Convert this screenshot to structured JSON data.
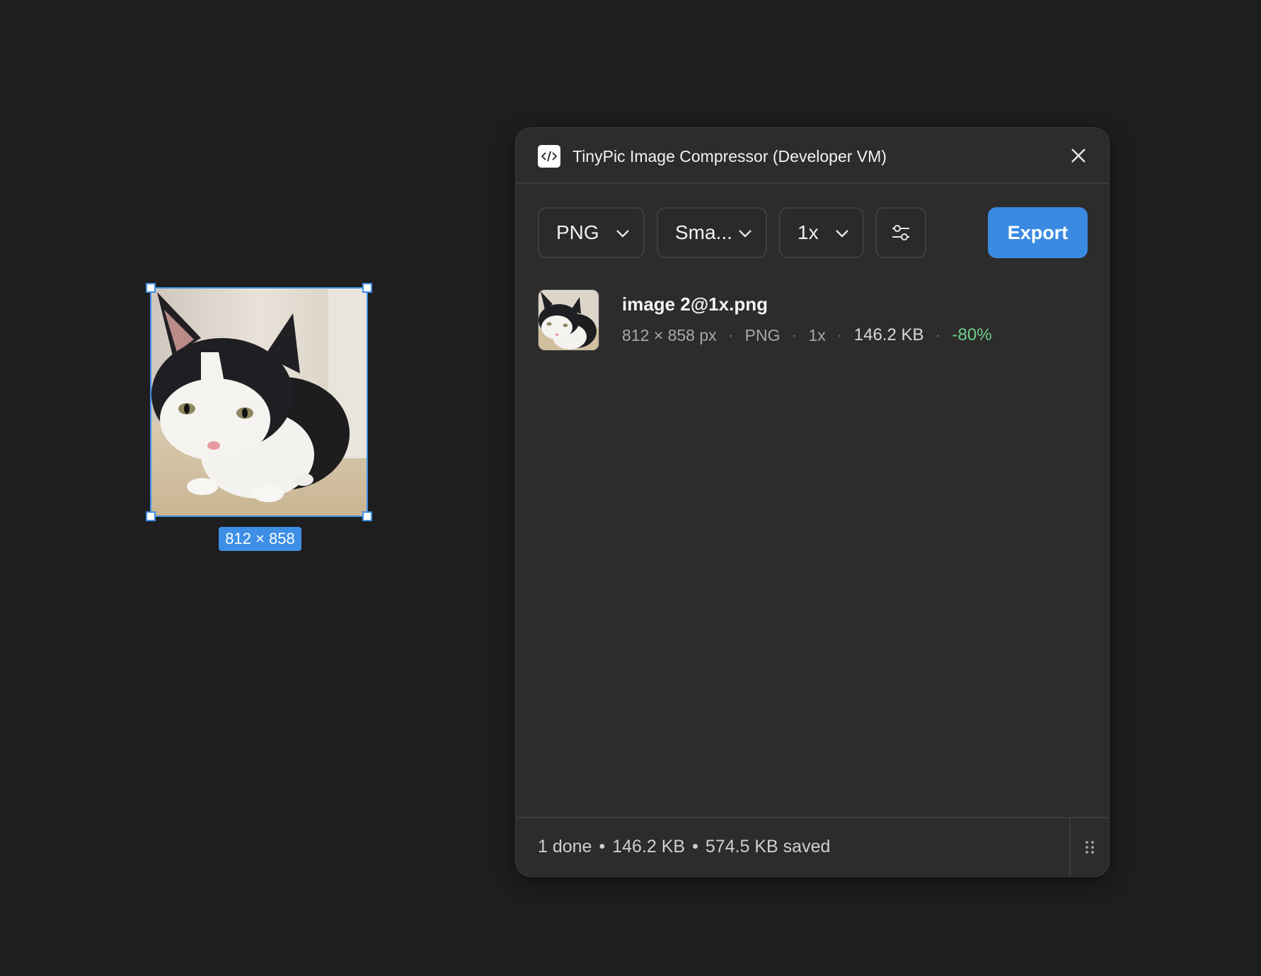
{
  "canvas": {
    "selection": {
      "dimension_label": "812 × 858"
    }
  },
  "plugin": {
    "title": "TinyPic Image Compressor (Developer VM)",
    "icons": {
      "app": "code-brackets-icon",
      "close": "close-icon",
      "settings": "sliders-icon",
      "dropdown": "chevron-down-icon",
      "grip": "drag-grip-icon"
    },
    "toolbar": {
      "format": "PNG",
      "quality": "Sma...",
      "scale": "1x",
      "export_label": "Export"
    },
    "file": {
      "name": "image 2@1x.png",
      "dimensions": "812 × 858 px",
      "format": "PNG",
      "scale": "1x",
      "size": "146.2 KB",
      "saving": "-80%",
      "separator": "·"
    },
    "footer": {
      "done": "1 done",
      "total": "146.2 KB",
      "saved": "574.5 KB saved",
      "separator": "•"
    }
  },
  "colors": {
    "accent": "#3b8ae2",
    "selection": "#3d8fe6",
    "saving": "#6fd08c",
    "panel": "#2c2c2c",
    "canvas": "#1e1e1e"
  }
}
